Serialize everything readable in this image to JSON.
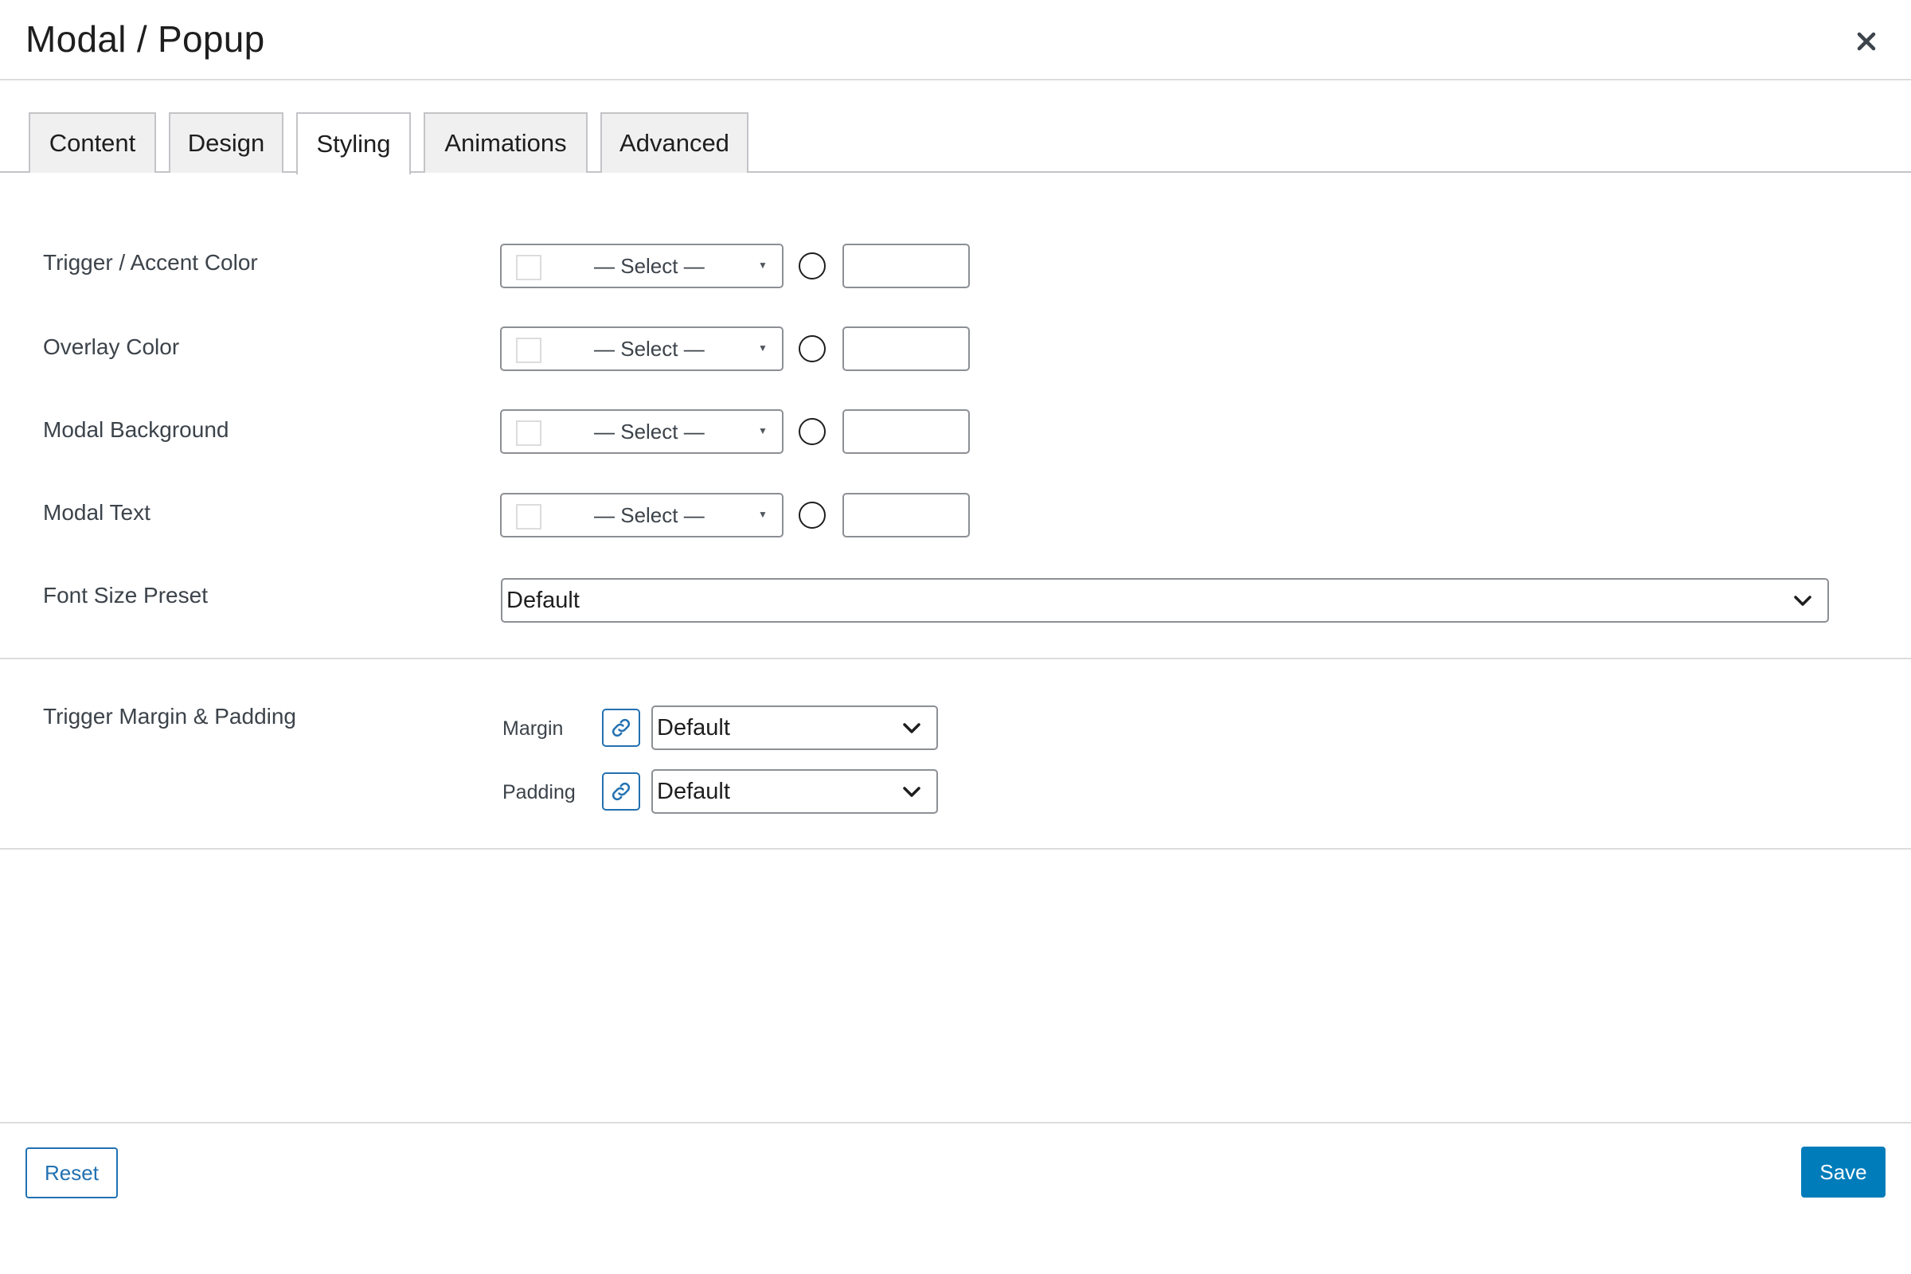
{
  "header": {
    "title": "Modal / Popup",
    "close_icon": "close-icon"
  },
  "tabs": [
    {
      "label": "Content",
      "active": false
    },
    {
      "label": "Design",
      "active": false
    },
    {
      "label": "Styling",
      "active": true
    },
    {
      "label": "Animations",
      "active": false
    },
    {
      "label": "Advanced",
      "active": false
    }
  ],
  "color_rows": [
    {
      "label": "Trigger / Accent Color",
      "select_placeholder": "— Select —",
      "hex_value": ""
    },
    {
      "label": "Overlay Color",
      "select_placeholder": "— Select —",
      "hex_value": ""
    },
    {
      "label": "Modal Background",
      "select_placeholder": "— Select —",
      "hex_value": ""
    },
    {
      "label": "Modal Text",
      "select_placeholder": "— Select —",
      "hex_value": ""
    }
  ],
  "font_size": {
    "label": "Font Size Preset",
    "value": "Default"
  },
  "spacing": {
    "label": "Trigger Margin & Padding",
    "margin": {
      "label": "Margin",
      "value": "Default",
      "icon": "link-icon"
    },
    "padding": {
      "label": "Padding",
      "value": "Default",
      "icon": "link-icon"
    }
  },
  "footer": {
    "reset_label": "Reset",
    "save_label": "Save"
  },
  "colors": {
    "accent": "#2271b1",
    "primary_button": "#007cba",
    "border": "#8c8f94"
  }
}
